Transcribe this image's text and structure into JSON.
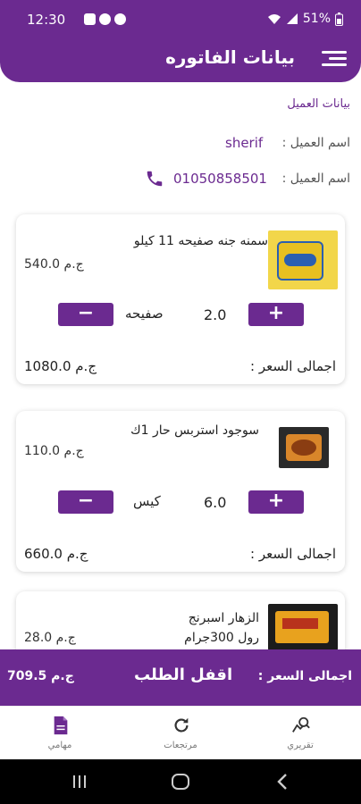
{
  "status_bar": {
    "time": "12:30",
    "battery": "51%"
  },
  "app_bar": {
    "title": "بيانات الفاتوره"
  },
  "customer": {
    "section_label": "بيانات العميل",
    "name_label": "اسم العميل :",
    "name_value": "sherif",
    "phone_label": "اسم العميل :",
    "phone_value": "01050858501"
  },
  "items": [
    {
      "name": "سمنه جنه صفيحه 11 كيلو",
      "unit_price": "540.0 ج.م",
      "quantity": "2.0",
      "unit": "صفيحه",
      "total_label": "اجمالى السعر :",
      "total_value": "1080.0 ج.م"
    },
    {
      "name": "سوجود استربس حار 1ك",
      "unit_price": "110.0 ج.م",
      "quantity": "6.0",
      "unit": "كيس",
      "total_label": "اجمالى السعر :",
      "total_value": "660.0 ج.م"
    },
    {
      "name_line1": "الزهار اسبرنج",
      "name_line2": "رول 300جرام",
      "unit_price": "28.0 ج.م"
    }
  ],
  "total_bar": {
    "label": "اجمالى السعر :",
    "close_order": "اقفل الطلب",
    "value": "709.5 ج.م"
  },
  "bottom_nav": [
    {
      "label": "تقريري",
      "icon": "report-search-icon"
    },
    {
      "label": "مرتجعات",
      "icon": "refresh-icon"
    },
    {
      "label": "مهامي",
      "icon": "document-icon"
    }
  ],
  "colors": {
    "primary": "#6b2a90",
    "card_bg": "#ffffff",
    "text": "#222222"
  }
}
